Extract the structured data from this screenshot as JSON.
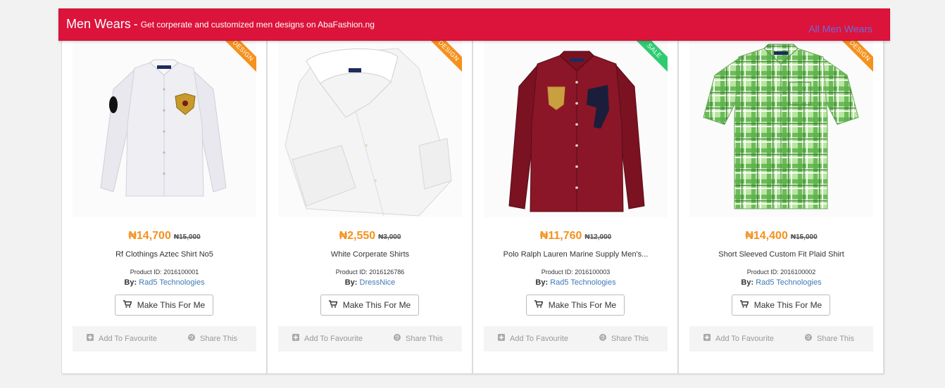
{
  "header": {
    "title": "Men Wears",
    "separator": "-",
    "subtitle": "Get corperate and customized men designs on AbaFashion.ng",
    "all_link": "All Men Wears"
  },
  "colors": {
    "header_bg": "#dc133b",
    "price": "#f5911e",
    "ribbon_design": "#f5911e",
    "ribbon_sale": "#2ecc71",
    "vendor_link": "#3d7ab8"
  },
  "products": [
    {
      "ribbon": "DESIGN",
      "price": "₦14,700",
      "old_price": "₦15,000",
      "name": "Rf Clothings Aztec Shirt No5",
      "product_id": "Product ID: 2016100001",
      "by_label": "By:",
      "vendor": "Rad5 Technologies",
      "button": "Make This For Me",
      "fav": "Add To Favourite",
      "share": "Share This",
      "image": "white-polo-shirt-with-crest"
    },
    {
      "ribbon": "DESIGN",
      "price": "₦2,550",
      "old_price": "₦3,000",
      "name": "White Corperate Shirts",
      "product_id": "Product ID: 2016126786",
      "by_label": "By:",
      "vendor": "DressNice",
      "button": "Make This For Me",
      "fav": "Add To Favourite",
      "share": "Share This",
      "image": "folded-white-shirt"
    },
    {
      "ribbon": "SALE",
      "price": "₦11,760",
      "old_price": "₦12,000",
      "name": "Polo Ralph Lauren Marine Supply Men's...",
      "product_id": "Product ID: 2016100003",
      "by_label": "By:",
      "vendor": "Rad5 Technologies",
      "button": "Make This For Me",
      "fav": "Add To Favourite",
      "share": "Share This",
      "image": "maroon-polo-shirt"
    },
    {
      "ribbon": "DESIGN",
      "price": "₦14,400",
      "old_price": "₦15,000",
      "name": "Short Sleeved Custom Fit Plaid Shirt",
      "product_id": "Product ID: 2016100002",
      "by_label": "By:",
      "vendor": "Rad5 Technologies",
      "button": "Make This For Me",
      "fav": "Add To Favourite",
      "share": "Share This",
      "image": "green-plaid-shirt"
    }
  ]
}
